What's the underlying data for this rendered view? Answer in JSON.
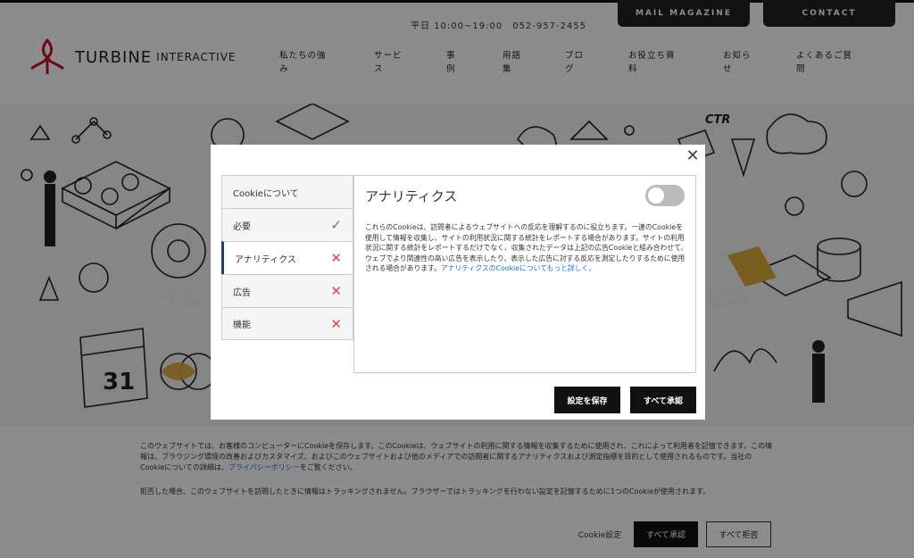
{
  "header": {
    "logo_main": "TURBINE",
    "logo_sub": "INTERACTIVE",
    "hours": "平日 10:00~19:00　052-957-2455",
    "mail_magazine": "MAIL MAGAZINE",
    "contact": "CONTACT",
    "nav": [
      {
        "l1": "私たちの強",
        "l2": "み"
      },
      {
        "l1": "サービ",
        "l2": "ス"
      },
      {
        "l1": "事",
        "l2": "例"
      },
      {
        "l1": "用語",
        "l2": "集"
      },
      {
        "l1": "ブロ",
        "l2": "グ"
      },
      {
        "l1": "お役立ち資",
        "l2": "料"
      },
      {
        "l1": "お知ら",
        "l2": "せ"
      },
      {
        "l1": "よくあるご質",
        "l2": "問"
      }
    ]
  },
  "hero": {
    "left_text": "イン",
    "right_text": "ビス",
    "calendar_number": "31",
    "ctr_label": "CTR"
  },
  "modal": {
    "close": "✕",
    "tabs": [
      {
        "label": "Cookieについて",
        "mark": ""
      },
      {
        "label": "必要",
        "mark": "✓"
      },
      {
        "label": "アナリティクス",
        "mark": "✕"
      },
      {
        "label": "広告",
        "mark": "✕"
      },
      {
        "label": "機能",
        "mark": "✕"
      }
    ],
    "panel_title": "アナリティクス",
    "panel_text": "これらのCookieは、訪問者によるウェブサイトへの反応を理解するのに役立ちます。一連のCookieを使用して情報を収集し、サイトの利用状況に関する統計をレポートする場合があります。サイトの利用状況に関する統計をレポートするだけでなく、収集されたデータは上記の広告Cookieと組み合わせて、ウェブでより関連性の高い広告を表示したり、表示した広告に対する反応を測定したりするために使用される場合があります。",
    "panel_link": "アナリティクスのCookieについてもっと詳しく。",
    "save_button": "設定を保存",
    "accept_all_button": "すべて承認"
  },
  "banner": {
    "para1": "このウェブサイトでは、お客様のコンピューターにCookieを保存します。このCookieは、ウェブサイトの利用に関する情報を収集するために使用され、これによって利用者を記憶できます。この情報は、ブラウジング環境の改善およびカスタマイズ、およびこのウェブサイトおよび他のメディアでの訪問者に関するアナリティクスおよび測定指標を目的として使用されるものです。当社のCookieについての詳細は、",
    "privacy_link": "プライバシーポリシー",
    "para1_end": "をご覧ください。",
    "para2": "拒否した場合、このウェブサイトを訪問したときに情報はトラッキングされません。ブラウザーではトラッキングを行わない設定を記憶するために1つのCookieが使用されます。",
    "settings_link": "Cookie設定",
    "accept_all": "すべて承認",
    "reject_all": "すべて拒否"
  },
  "colors": {
    "logo_red": "#c8102e",
    "check_green": "#2a9a5a",
    "cross_red": "#e0424a",
    "link_blue": "#1a75c4",
    "dark": "#111111"
  }
}
